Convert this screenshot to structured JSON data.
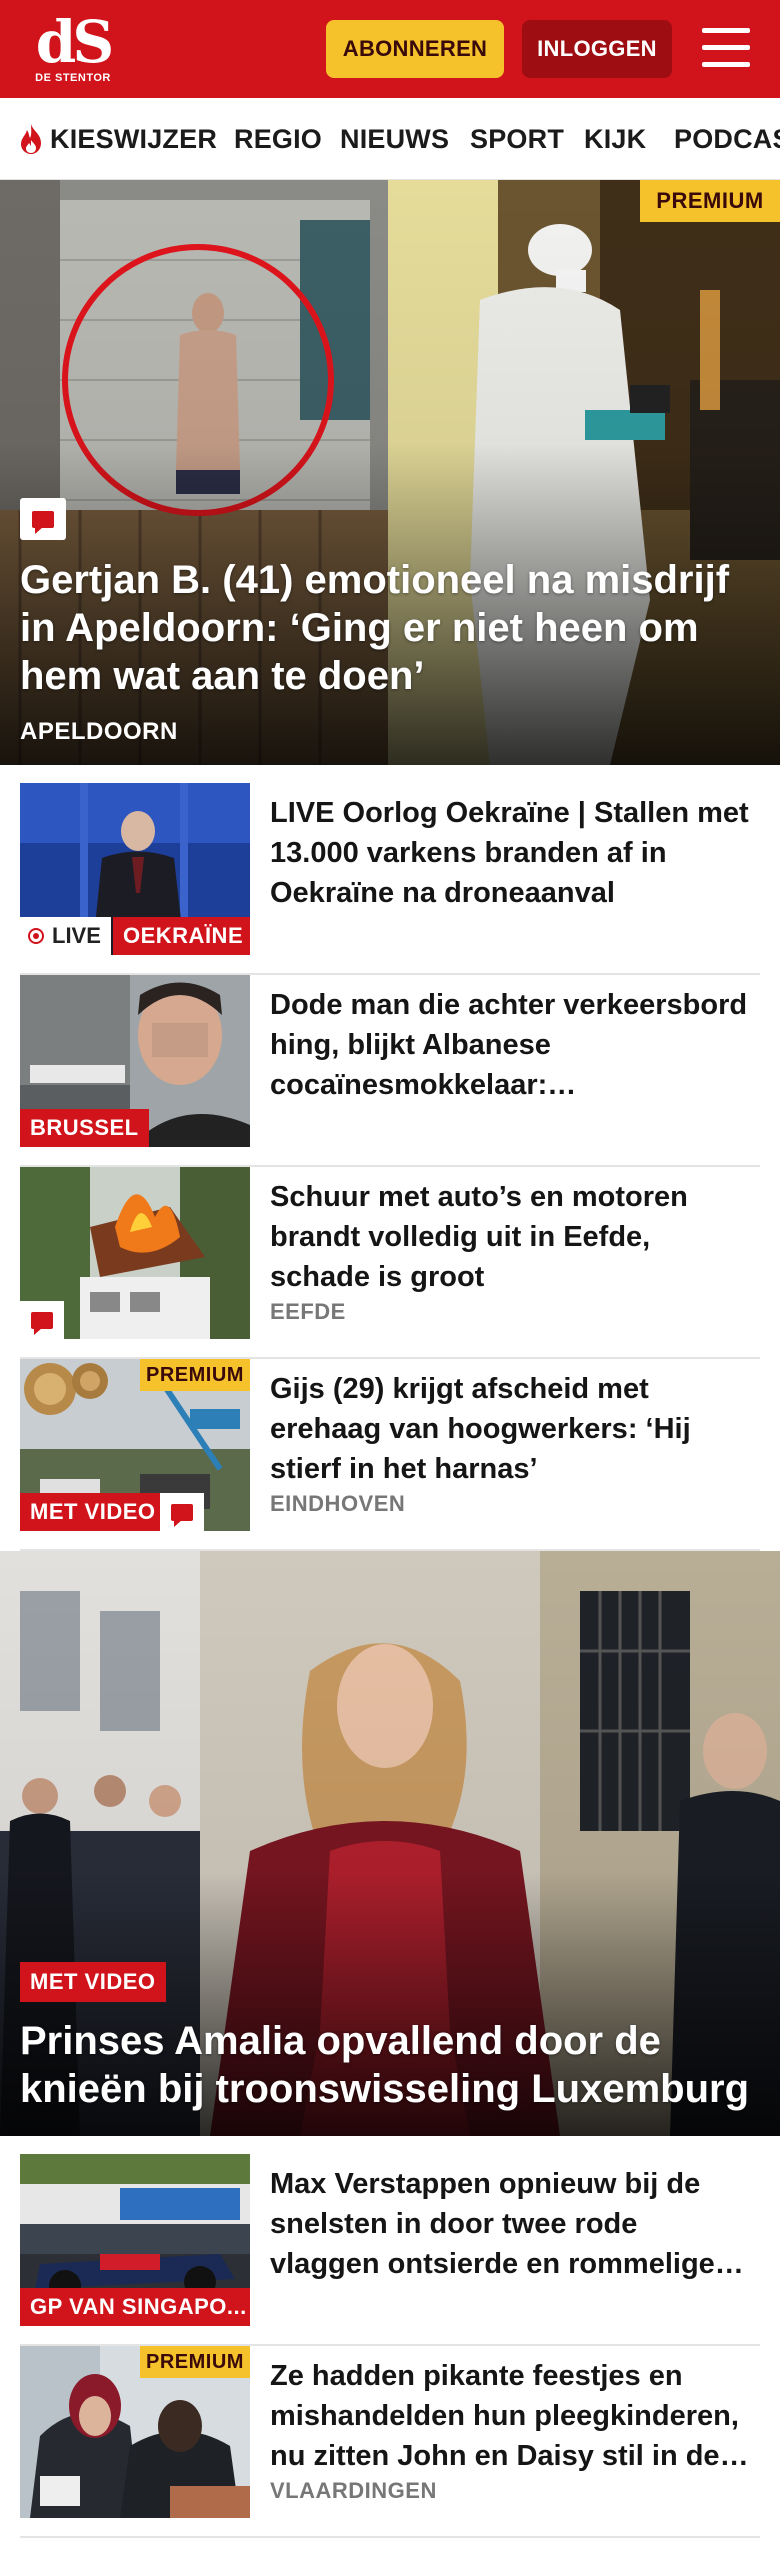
{
  "header": {
    "logo_mark": "dS",
    "logo_name": "DE STENTOR",
    "subscribe_label": "ABONNEREN",
    "login_label": "INLOGGEN",
    "brand_color": "#d1141b",
    "accent_color": "#f5c22c"
  },
  "nav": {
    "items": [
      {
        "label": "KIESWIJZER",
        "icon": "flame-icon"
      },
      {
        "label": "REGIO"
      },
      {
        "label": "NIEUWS"
      },
      {
        "label": "SPORT"
      },
      {
        "label": "KIJK"
      },
      {
        "label": "PODCAS"
      }
    ]
  },
  "hero1": {
    "premium": "PREMIUM",
    "title": "Gertjan B. (41) emotioneel na misdrijf in Apeldoorn: ‘Ging er niet heen om hem wat aan te doen’",
    "location": "APELDOORN",
    "icon": "comment-icon"
  },
  "articles": [
    {
      "title": "LIVE Oorlog Oekraïne | Stallen met 13.000 varkens branden af in Oekraïne na droneaanval",
      "live_label": "LIVE",
      "tag": "OEKRAÏNE"
    },
    {
      "title": "Dode man die achter verkeers­bord hing, blijkt Albanese cocaïnesmokkelaar: 'Geëxecuteerd'",
      "tag": "BRUSSEL"
    },
    {
      "title": "Schuur met auto’s en motoren brandt volledig uit in Eefde, schade is groot",
      "location": "EEFDE",
      "icon": "comment-icon"
    },
    {
      "title": "Gijs (29) krijgt afscheid met erehaag van hoogwerkers: ‘Hij stierf in het harnas’",
      "location": "EINDHOVEN",
      "premium": "PREMIUM",
      "tag": "MET VIDEO",
      "icon": "comment-icon"
    }
  ],
  "hero2": {
    "tag": "MET VIDEO",
    "title": "Prinses Amalia opvallend door de knieën bij troonswisseling Luxemburg"
  },
  "articles2": [
    {
      "title": "Max Verstappen opnieuw bij de snelsten in door twee rode vlaggen ontsierde en rommelige training",
      "tag": "GP VAN SINGAPO..."
    },
    {
      "title": "Ze hadden pikante feestjes en mishandelden hun pleegkinde­ren, nu zitten John en Daisy stil in de rechtszaal",
      "location": "VLAARDINGEN",
      "premium": "PREMIUM"
    }
  ]
}
